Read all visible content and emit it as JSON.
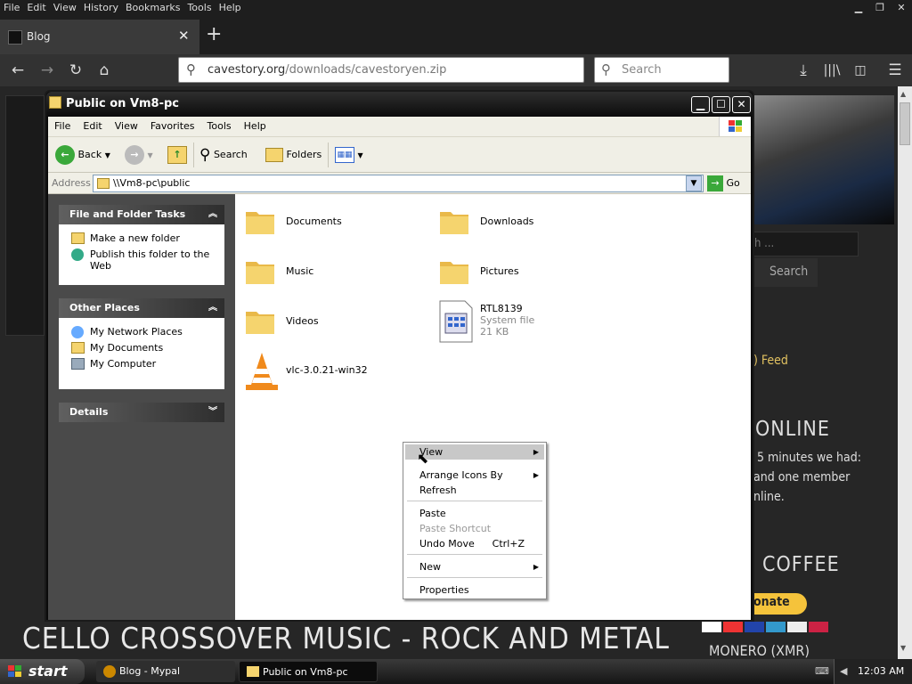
{
  "browser": {
    "menu": [
      "File",
      "Edit",
      "View",
      "History",
      "Bookmarks",
      "Tools",
      "Help"
    ],
    "tab_title": "Blog",
    "url_host": "cavestory.org",
    "url_path": "/downloads/cavestoryen.zip",
    "search_placeholder": "Search"
  },
  "webpage": {
    "search_button": "Search",
    "search_hint": "h ...",
    "feed_text": "Feed",
    "online_title": "ONLINE",
    "online_line1": "5 minutes we had:",
    "online_line2": "and one member",
    "online_line3": "nline.",
    "coffee_title": "COFFEE",
    "donate_label": "onate",
    "monero_label": "MONERO (XMR)",
    "banner_text": "CELLO CROSSOVER MUSIC - ROCK AND METAL"
  },
  "explorer": {
    "title": "Public on Vm8-pc",
    "menu": [
      "File",
      "Edit",
      "View",
      "Favorites",
      "Tools",
      "Help"
    ],
    "toolbar": {
      "back": "Back",
      "search": "Search",
      "folders": "Folders"
    },
    "address_label": "Address",
    "address_value": "\\\\Vm8-pc\\public",
    "go_label": "Go",
    "tasks_title": "File and Folder Tasks",
    "tasks": [
      "Make a new folder",
      "Publish this folder to the Web"
    ],
    "places_title": "Other Places",
    "places": [
      "My Network Places",
      "My Documents",
      "My Computer"
    ],
    "details_title": "Details",
    "items": [
      {
        "name": "Documents"
      },
      {
        "name": "Downloads"
      },
      {
        "name": "Music"
      },
      {
        "name": "Pictures"
      },
      {
        "name": "Videos"
      },
      {
        "name": "RTL8139",
        "type": "System file",
        "size": "21 KB"
      },
      {
        "name": "vlc-3.0.21-win32"
      }
    ]
  },
  "context_menu": {
    "view": "View",
    "arrange": "Arrange Icons By",
    "refresh": "Refresh",
    "paste": "Paste",
    "paste_shortcut": "Paste Shortcut",
    "undo_move": "Undo Move",
    "undo_shortcut": "Ctrl+Z",
    "new": "New",
    "properties": "Properties"
  },
  "taskbar": {
    "start": "start",
    "tasks": [
      "Blog - Mypal",
      "Public on Vm8-pc"
    ],
    "clock": "12:03 AM"
  },
  "colors": {
    "folder": "#f5d46e",
    "accent_green": "#3aa83a",
    "xp_title": "#1a1a1a"
  }
}
